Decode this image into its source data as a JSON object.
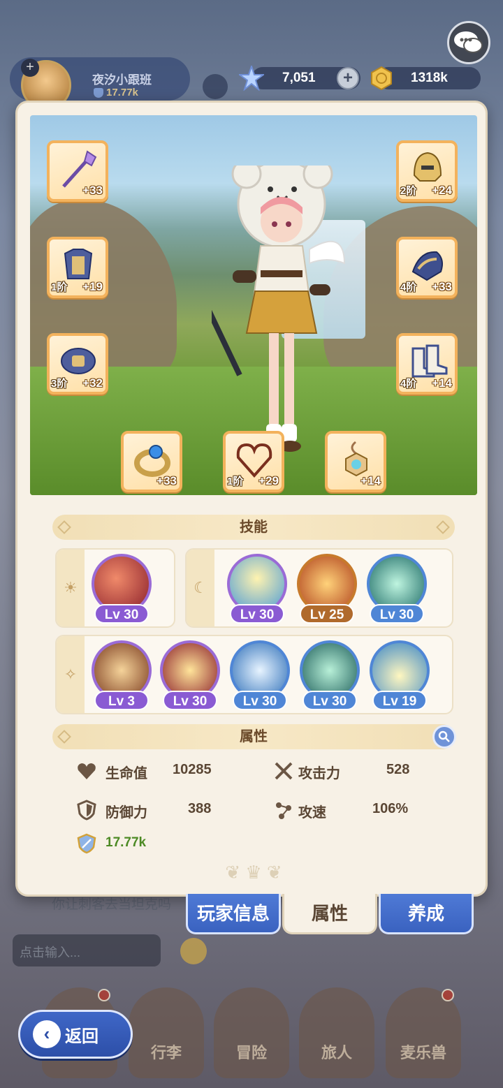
{
  "hud": {
    "player_name": "夜汐小跟班",
    "player_power": "17.77k",
    "gems": "7,051",
    "gold": "1318k"
  },
  "equipment": {
    "staff": {
      "enh": "+33",
      "tier": ""
    },
    "helmet": {
      "enh": "+24",
      "tier": "2阶"
    },
    "armor": {
      "enh": "+19",
      "tier": "1阶"
    },
    "gloves": {
      "enh": "+33",
      "tier": "4阶"
    },
    "belt": {
      "enh": "+32",
      "tier": "3阶"
    },
    "boots": {
      "enh": "+14",
      "tier": "4阶"
    },
    "ring": {
      "enh": "+33",
      "tier": ""
    },
    "necklace": {
      "enh": "+29",
      "tier": "1阶"
    },
    "amulet": {
      "enh": "+14",
      "tier": ""
    }
  },
  "skills_title": "技能",
  "skills": {
    "sun": [
      {
        "level": "Lv 30"
      }
    ],
    "moon": [
      {
        "level": "Lv 30"
      },
      {
        "level": "Lv 25"
      },
      {
        "level": "Lv 30"
      }
    ],
    "star": [
      {
        "level": "Lv 3"
      },
      {
        "level": "Lv 30"
      },
      {
        "level": "Lv 30"
      },
      {
        "level": "Lv 30"
      },
      {
        "level": "Lv 19"
      }
    ]
  },
  "attributes_title": "属性",
  "attributes": {
    "hp_label": "生命值",
    "hp_value": "10285",
    "atk_label": "攻击力",
    "atk_value": "528",
    "def_label": "防御力",
    "def_value": "388",
    "spd_label": "攻速",
    "spd_value": "106%",
    "power_value": "17.77k"
  },
  "tabs": {
    "player_info": "玩家信息",
    "attributes": "属性",
    "cultivate": "养成"
  },
  "background": {
    "chat_text": "你让刺客去当坦克吗",
    "input_placeholder": "点击输入..."
  },
  "bottom_nav": {
    "bag": "行李",
    "adventure": "冒险",
    "traveler": "旅人",
    "pet": "麦乐兽"
  },
  "back_label": "返回",
  "colors": {
    "panel_bg": "#f7f1e6",
    "slot_border": "#f3b25c",
    "accent_blue": "#3a62c0",
    "power_green": "#4c8a24"
  }
}
